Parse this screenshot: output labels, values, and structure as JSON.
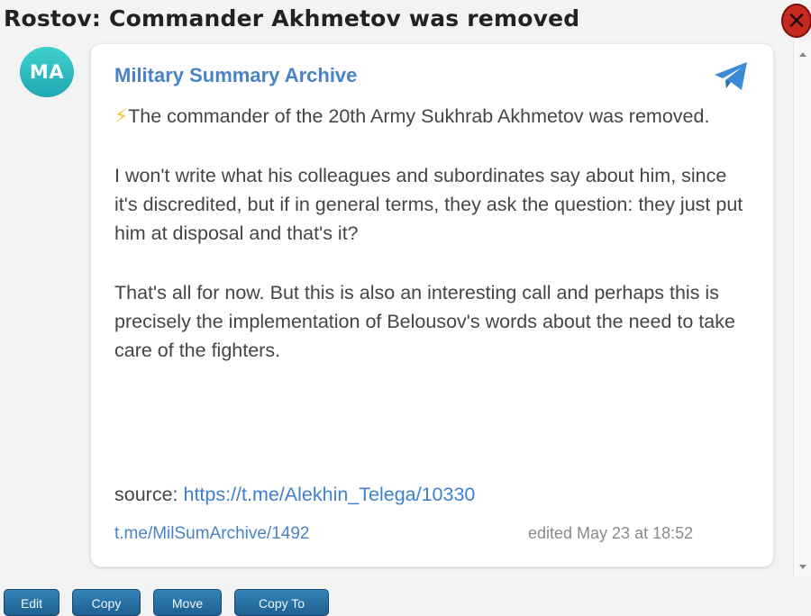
{
  "window": {
    "title": "Rostov: Commander Akhmetov was removed",
    "close_glyph": "✕"
  },
  "post": {
    "avatar_initials": "MA",
    "channel_name": "Military Summary Archive",
    "icon": "telegram-icon",
    "bolt_glyph": "⚡",
    "paragraphs": [
      "The commander of the 20th Army Sukhrab Akhmetov was removed.",
      "I won't write what his colleagues and subordinates say about him, since it's discredited, but if in general terms, they ask the question: they just put him at disposal and that's it?",
      "That's all for now. But this is also an interesting call and perhaps this is precisely the implementation of Belousov's words about the need to take care of the fighters."
    ],
    "source_label": "source: ",
    "source_url": "https://t.me/Alekhin_Telega/10330",
    "post_link": "t.me/MilSumArchive/1492",
    "edited_text": "edited  May 23 at 18:52"
  },
  "toolbar": {
    "edit_label": "Edit",
    "copy_label": "Copy",
    "move_label": "Move",
    "copy_to_label": "Copy To"
  },
  "colors": {
    "accent": "#4a82c6",
    "avatar": "#2ab8bf",
    "close": "#c62a1f",
    "button": "#2a70a3"
  }
}
